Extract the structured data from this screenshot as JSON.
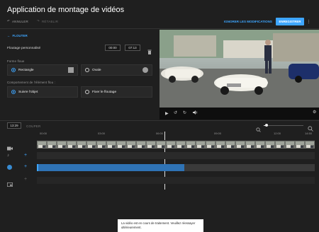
{
  "header": {
    "title": "Application de montage de vidéos",
    "undo_label": "ANNULER",
    "redo_label": "RÉTABLIR",
    "discard_label": "IGNORER LES MODIFICATIONS",
    "save_label": "ENREGISTRER"
  },
  "blur_panel": {
    "back_label": "FLOUTER",
    "custom_blur_label": "Floutage personnalisé",
    "start_time": "00:00",
    "end_time": "07:13",
    "shape_label": "Forme floue",
    "shape_options": [
      "Rectangle",
      "Ovale"
    ],
    "behavior_label": "Comportement de l'élément flou :",
    "behavior_options": [
      "Suivre l'objet",
      "Fixer le floutage"
    ]
  },
  "timeline": {
    "current_time": "13:29",
    "cut_label": "COUPER",
    "ruler": [
      "00:00",
      "03:00",
      "06:00",
      "09:00",
      "12:00",
      "14:50"
    ],
    "progress": 0.53
  },
  "toast": {
    "message": "La vidéo est en cours de traitement. Veuillez réessayer ultérieurement."
  },
  "colors": {
    "accent": "#3ea6ff",
    "background": "#1f1f1f"
  }
}
